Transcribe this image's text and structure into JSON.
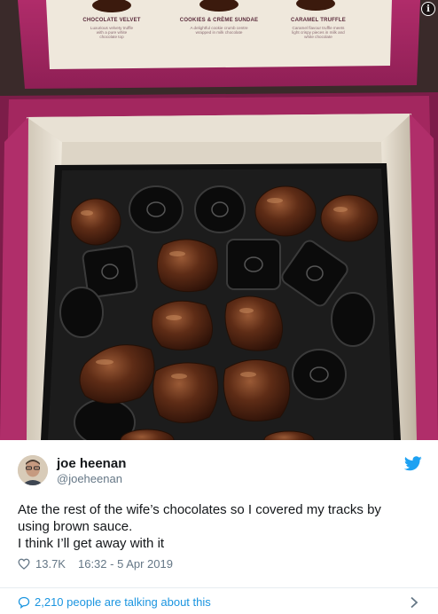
{
  "photo": {
    "cards": [
      {
        "title": "CHOCOLATE VELVET",
        "desc": [
          "Luxurious velvety truffle",
          "with a pure white",
          "chocolate top"
        ]
      },
      {
        "title": "COOKIES & CRÈME SUNDAE",
        "desc": [
          "A delightful cookie crumb centre",
          "wrapped in milk chocolate"
        ]
      },
      {
        "title": "CARAMEL TRUFFLE",
        "desc": [
          "Caramel flavour truffle meets",
          "light crispy pieces in milk and",
          "white chocolate"
        ]
      }
    ],
    "info_icon_glyph": "i"
  },
  "tweet": {
    "display_name": "joe heenan",
    "handle": "@joeheenan",
    "text_lines": [
      "Ate the rest of the wife’s chocolates so I covered my tracks by",
      "using brown sauce.",
      "I think I’ll get away with it"
    ],
    "likes": "13.7K",
    "timestamp": "16:32 - 5 Apr 2019",
    "talking": "2,210 people are talking about this",
    "icons": {
      "brand": "twitter-bird-icon",
      "like": "heart-icon",
      "reply": "speech-bubble-icon",
      "more": "chevron-right-icon"
    },
    "colors": {
      "link": "#1b95e0",
      "secondary": "#657786",
      "brand": "#1da1f2"
    }
  }
}
